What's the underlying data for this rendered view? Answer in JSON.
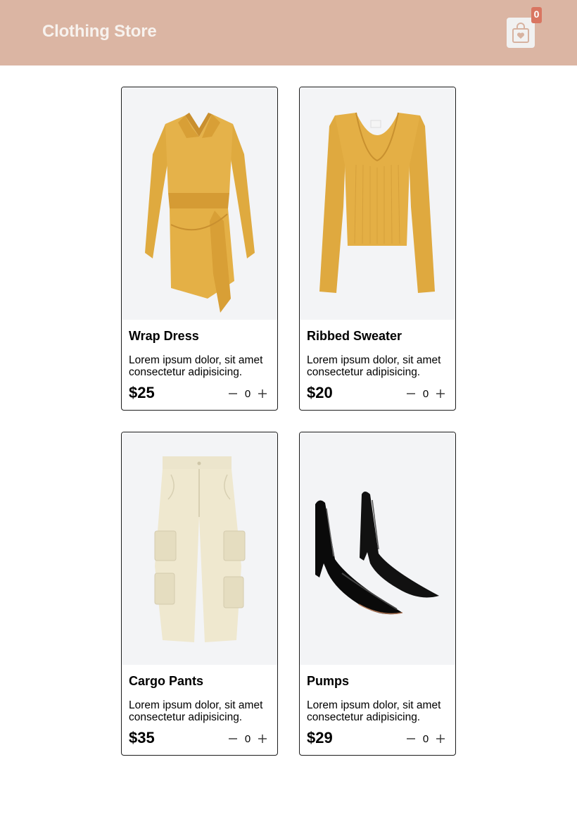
{
  "header": {
    "title": "Clothing Store",
    "cart_icon": "shopping-bag-icon",
    "cart_count": "0"
  },
  "colors": {
    "header_bg": "#dbb5a3",
    "badge_bg": "#d97561",
    "image_bg": "#f3f4f6"
  },
  "products": [
    {
      "name": "Wrap Dress",
      "description": "Lorem ipsum dolor, sit amet consectetur adipisicing.",
      "price": "$25",
      "quantity": "0",
      "image": "yellow-wrap-dress",
      "decrement_icon": "minus-icon",
      "increment_icon": "plus-icon"
    },
    {
      "name": "Ribbed Sweater",
      "description": "Lorem ipsum dolor, sit amet consectetur adipisicing.",
      "price": "$20",
      "quantity": "0",
      "image": "yellow-ribbed-sweater",
      "decrement_icon": "minus-icon",
      "increment_icon": "plus-icon"
    },
    {
      "name": "Cargo Pants",
      "description": "Lorem ipsum dolor, sit amet consectetur adipisicing.",
      "price": "$35",
      "quantity": "0",
      "image": "cream-cargo-pants",
      "decrement_icon": "minus-icon",
      "increment_icon": "plus-icon"
    },
    {
      "name": "Pumps",
      "description": "Lorem ipsum dolor, sit amet consectetur adipisicing.",
      "price": "$29",
      "quantity": "0",
      "image": "black-patent-pumps",
      "decrement_icon": "minus-icon",
      "increment_icon": "plus-icon"
    }
  ]
}
